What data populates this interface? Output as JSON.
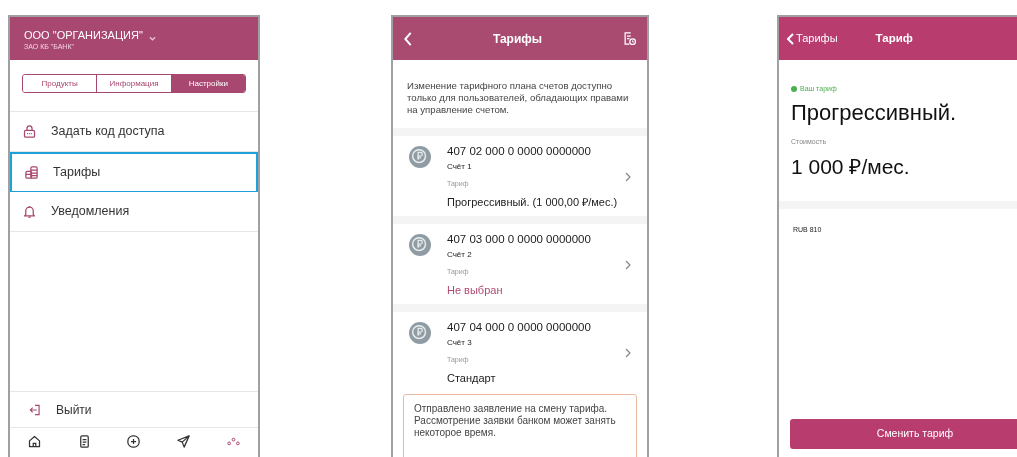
{
  "settings_screen": {
    "header": {
      "organization": "ООО \"ОРГАНИЗАЦИЯ\"",
      "bank": "ЗАО КБ \"БАНК\""
    },
    "tabs": [
      {
        "label": "Продукты",
        "selected": false
      },
      {
        "label": "Информация",
        "selected": false
      },
      {
        "label": "Настройки",
        "selected": true
      }
    ],
    "menu_items": [
      {
        "kind": "lock",
        "label": "Задать код доступа",
        "selected": false
      },
      {
        "kind": "coins",
        "label": "Тарифы",
        "selected": true
      },
      {
        "kind": "bell",
        "label": "Уведомления",
        "selected": false
      }
    ],
    "logout": {
      "label": "Выйти"
    },
    "bottom_nav": [
      {
        "kind": "home",
        "selected": false
      },
      {
        "kind": "document",
        "selected": false
      },
      {
        "kind": "plus",
        "selected": false
      },
      {
        "kind": "send",
        "selected": false
      },
      {
        "kind": "more",
        "selected": true
      }
    ]
  },
  "tariffs_screen": {
    "title": "Тарифы",
    "info": "Изменение тарифного плана счетов доступно только для пользователей, обладающих правами на управление счетом.",
    "accounts": [
      {
        "number": "407 02 000 0 0000 0000000",
        "name": "Счёт 1",
        "tariff_label": "Тариф",
        "tariff": "Прогрессивный. (1 000,00 ₽/мес.)",
        "tariff_chosen": true
      },
      {
        "number": "407 03 000 0 0000 0000000",
        "name": "Счёт 2",
        "tariff_label": "Тариф",
        "tariff": "Не выбран",
        "tariff_chosen": false
      },
      {
        "number": "407 04 000 0 0000 0000000",
        "name": "Счёт 3",
        "tariff_label": "Тариф",
        "tariff": "Стандарт",
        "tariff_chosen": true
      }
    ],
    "notice": "Отправлено заявление на смену тарифа. Рассмотрение заявки банком может занять некоторое время."
  },
  "tariff_screen": {
    "back_label": "Тарифы",
    "title": "Тариф",
    "status": "Ваш тариф",
    "current": true,
    "tariff_name": "Прогрессивный.",
    "cost_label": "Стоимость",
    "cost": "1 000 ₽/мес.",
    "currency": "RUB 810",
    "button": "Сменить тариф"
  }
}
